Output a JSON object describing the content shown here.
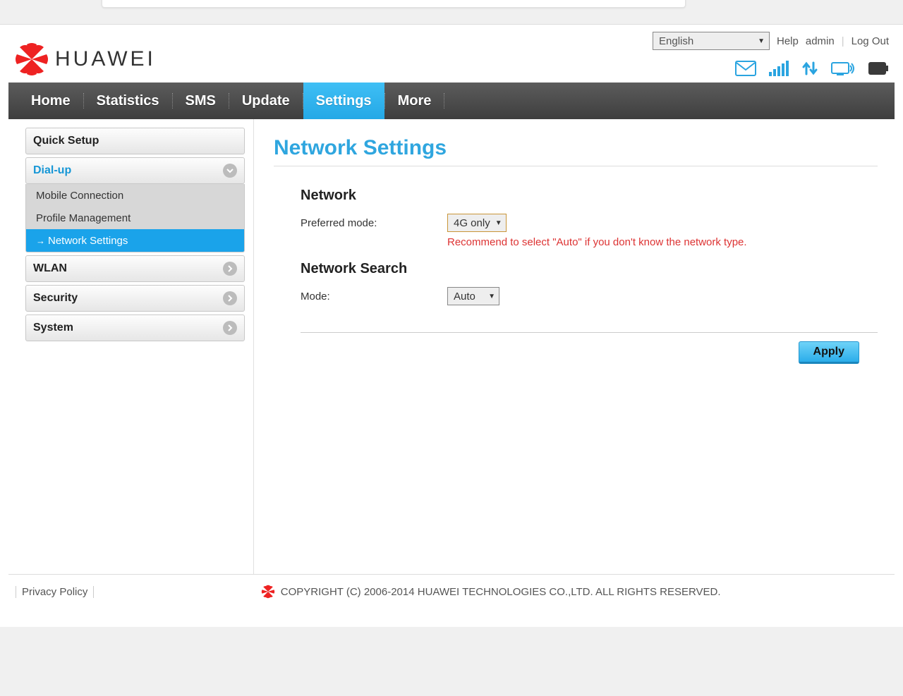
{
  "header": {
    "brand": "HUAWEI",
    "language": "English",
    "help": "Help",
    "user": "admin",
    "logout": "Log Out"
  },
  "nav": {
    "home": "Home",
    "statistics": "Statistics",
    "sms": "SMS",
    "update": "Update",
    "settings": "Settings",
    "more": "More"
  },
  "sidebar": {
    "quick_setup": "Quick Setup",
    "dialup": "Dial-up",
    "dialup_items": {
      "mobile": "Mobile Connection",
      "profile": "Profile Management",
      "network": "Network Settings"
    },
    "wlan": "WLAN",
    "security": "Security",
    "system": "System"
  },
  "main": {
    "title": "Network Settings",
    "network_section": "Network",
    "preferred_mode_label": "Preferred mode:",
    "preferred_mode_value": "4G only",
    "preferred_hint": "Recommend to select \"Auto\" if you don't know the network type.",
    "search_section": "Network Search",
    "mode_label": "Mode:",
    "mode_value": "Auto",
    "apply": "Apply"
  },
  "footer": {
    "privacy": "Privacy Policy",
    "copyright": "COPYRIGHT (C) 2006-2014 HUAWEI TECHNOLOGIES CO.,LTD. ALL RIGHTS RESERVED."
  }
}
